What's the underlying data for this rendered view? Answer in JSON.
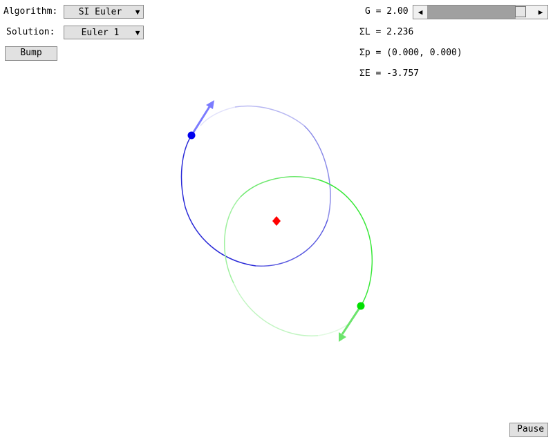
{
  "controls": {
    "algorithm_label": "Algorithm:",
    "algorithm_value": "SI Euler",
    "solution_label": "Solution:",
    "solution_value": "Euler 1",
    "bump_label": "Bump",
    "pause_label": "Pause"
  },
  "gravity": {
    "label": "G = 2.00",
    "value": 2.0,
    "slider_fraction": 0.92
  },
  "stats": {
    "angular_momentum": "ΣL = 2.236",
    "momentum": "Σp = (0.000, 0.000)",
    "energy": "ΣE = -3.757"
  },
  "colors": {
    "center_body": "#ff0000",
    "blue_body": "#0000ee",
    "green_body": "#00e000",
    "blue_velocity": "#7b7bff",
    "green_velocity": "#6ce46c"
  },
  "icons": {
    "dropdown": "triangle-down-icon",
    "slider_left": "triangle-left-icon",
    "slider_right": "triangle-right-icon"
  }
}
